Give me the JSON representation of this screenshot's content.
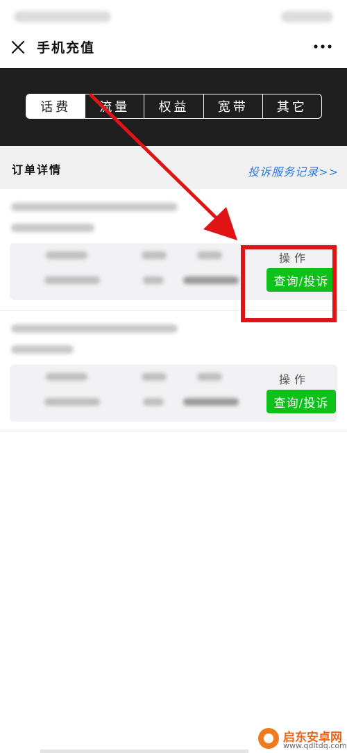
{
  "header": {
    "title": "手机充值"
  },
  "tabs": [
    {
      "label": "话费",
      "active": true
    },
    {
      "label": "流量",
      "active": false
    },
    {
      "label": "权益",
      "active": false
    },
    {
      "label": "宽带",
      "active": false
    },
    {
      "label": "其它",
      "active": false
    }
  ],
  "section": {
    "title": "订单详情",
    "complaint_link": "投诉服务记录>>"
  },
  "orders": [
    {
      "operation_label": "操作",
      "action_label": "查询/投诉"
    },
    {
      "operation_label": "操作",
      "action_label": "查询/投诉"
    }
  ],
  "watermark": {
    "name": "启东安卓网",
    "url": "www.qdltdq.com"
  },
  "colors": {
    "accent_green": "#0fbf1a",
    "link_blue": "#2f7be0",
    "highlight_red": "#e01414",
    "tab_band": "#1e1e1e"
  },
  "icons": [
    "close-icon",
    "more-icon"
  ]
}
